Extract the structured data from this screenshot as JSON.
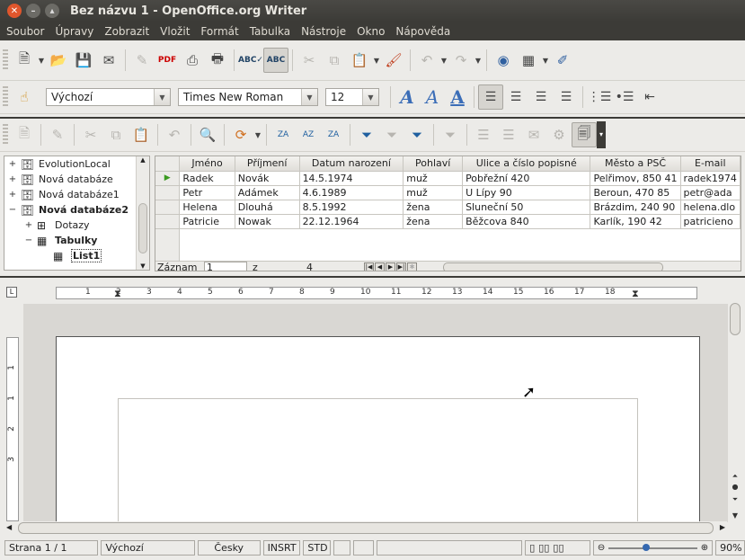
{
  "window": {
    "title": "Bez názvu 1 - OpenOffice.org Writer"
  },
  "menu": [
    "Soubor",
    "Úpravy",
    "Zobrazit",
    "Vložit",
    "Formát",
    "Tabulka",
    "Nástroje",
    "Okno",
    "Nápověda"
  ],
  "formatting": {
    "style_value": "Výchozí",
    "font_value": "Times New Roman",
    "size_value": "12"
  },
  "icons": {
    "new": "new-document-icon",
    "open": "open-folder-icon",
    "save": "save-icon",
    "email": "email-icon",
    "edit": "edit-file-icon",
    "pdf": "export-pdf-icon",
    "print": "print-icon",
    "preview": "print-preview-icon",
    "spell": "spellcheck-icon",
    "autospell": "autospellcheck-icon",
    "cut": "cut-icon",
    "copy": "copy-icon",
    "paste": "paste-icon",
    "brush": "format-paintbrush-icon",
    "undo": "undo-icon",
    "redo": "redo-icon",
    "navigator": "navigator-icon",
    "table": "insert-table-icon",
    "show-draw": "show-draw-functions-icon"
  },
  "datasources": {
    "tree": [
      {
        "label": "EvolutionLocal",
        "expander": "+",
        "level": 0,
        "bold": false,
        "icon": "database-icon"
      },
      {
        "label": "Nová databáze",
        "expander": "+",
        "level": 0,
        "bold": false,
        "icon": "database-icon"
      },
      {
        "label": "Nová databáze1",
        "expander": "+",
        "level": 0,
        "bold": false,
        "icon": "database-icon"
      },
      {
        "label": "Nová databáze2",
        "expander": "−",
        "level": 0,
        "bold": true,
        "icon": "database-icon"
      },
      {
        "label": "Dotazy",
        "expander": "+",
        "level": 1,
        "bold": false,
        "icon": "queries-icon"
      },
      {
        "label": "Tabulky",
        "expander": "−",
        "level": 1,
        "bold": true,
        "icon": "tables-icon"
      },
      {
        "label": "List1",
        "expander": "",
        "level": 2,
        "bold": true,
        "icon": "table-icon",
        "selected": true
      }
    ],
    "columns": [
      "Jméno",
      "Příjmení",
      "Datum narození",
      "Pohlaví",
      "Ulice a číslo popisné",
      "Město a PSČ",
      "E-mail"
    ],
    "rows": [
      [
        "Radek",
        "Novák",
        "14.5.1974",
        "muž",
        "Pobřežní 420",
        "Pelřimov, 850 41",
        "radek1974"
      ],
      [
        "Petr",
        "Adámek",
        "4.6.1989",
        "muž",
        "U Lípy 90",
        "Beroun, 470 85",
        "petr@ada"
      ],
      [
        "Helena",
        "Dlouhá",
        "8.5.1992",
        "žena",
        "Sluneční 50",
        "Brázdim, 240 90",
        "helena.dlo"
      ],
      [
        "Patricie",
        "Nowak",
        "22.12.1964",
        "žena",
        "Běžcova 840",
        "Karlík, 190 42",
        "patricieno"
      ]
    ],
    "record_label": "Záznam",
    "record_value": "1",
    "of_label": "z",
    "record_total": "4"
  },
  "ruler": {
    "h_labels": [
      "1",
      "2",
      "3",
      "4",
      "5",
      "6",
      "7",
      "8",
      "9",
      "10",
      "11",
      "12",
      "13",
      "14",
      "15",
      "16",
      "17",
      "18"
    ],
    "v_labels": [
      "1",
      "1",
      "2",
      "3"
    ]
  },
  "status": {
    "page": "Strana 1 / 1",
    "style": "Výchozí",
    "language": "Česky",
    "insert_mode": "INSRT",
    "selection_mode": "STD",
    "zoom": "90%"
  }
}
